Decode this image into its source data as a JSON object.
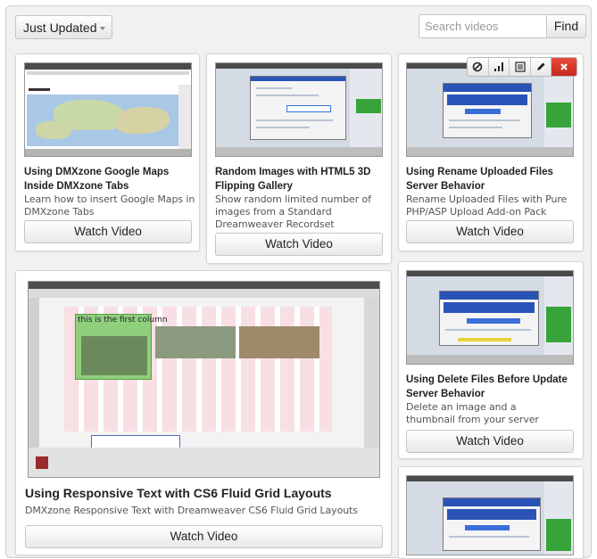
{
  "toolbar": {
    "filter_label": "Just Updated",
    "search_placeholder": "Search videos",
    "search_value": "",
    "find_label": "Find"
  },
  "cards": [
    {
      "title": "Using DMXzone Google Maps Inside DMXzone Tabs",
      "description": "Learn how to insert Google Maps in DMXzone Tabs",
      "button": "Watch Video"
    },
    {
      "title": "Random Images with HTML5 3D Flipping Gallery",
      "description": "Show random limited number of images from a Standard Dreamweaver Recordset",
      "button": "Watch Video"
    },
    {
      "title": "Using Rename Uploaded Files Server Behavior",
      "description": "Rename Uploaded Files with Pure PHP/ASP Upload Add-on Pack",
      "button": "Watch Video"
    },
    {
      "title": "Using Responsive Text with CS6 Fluid Grid Layouts",
      "description": "DMXzone Responsive Text with Dreamweaver CS6 Fluid Grid Layouts",
      "button": "Watch Video",
      "thumb_caption": "this is the first column"
    },
    {
      "title": "Using Delete Files Before Update Server Behavior",
      "description": "Delete an image and a thumbnail from your server",
      "button": "Watch Video"
    }
  ],
  "hover_tools": [
    "block-icon",
    "stats-icon",
    "list-icon",
    "edit-icon",
    "delete-icon"
  ],
  "colors": {
    "background": "#f1f1f1",
    "delete_button": "#d9362a",
    "card_border": "#d6d6d6"
  }
}
